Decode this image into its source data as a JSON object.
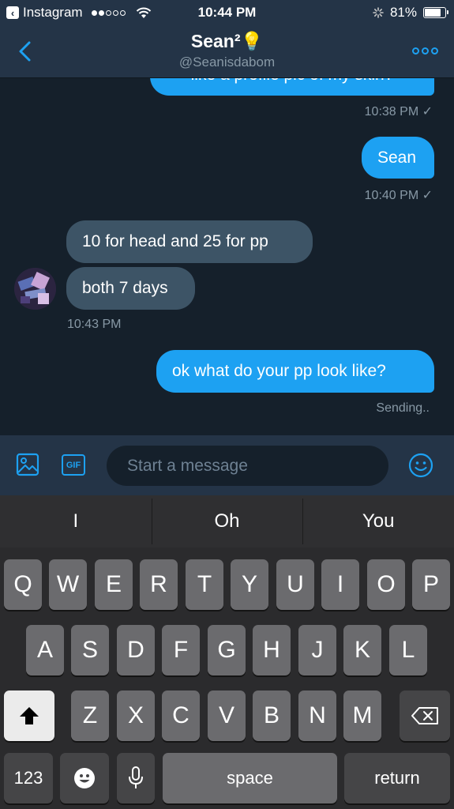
{
  "status_bar": {
    "back_app": "Instagram",
    "time": "10:44 PM",
    "battery": "81%",
    "battery_level": 0.81
  },
  "header": {
    "title": "Sean²💡",
    "handle": "@Seanisdabom"
  },
  "messages": {
    "m1": {
      "text": "like a profile pic of my skin?",
      "meta": "10:38 PM ✓"
    },
    "m2": {
      "text": "Sean",
      "meta": "10:40 PM ✓"
    },
    "m3": {
      "text": "10 for head and 25 for pp"
    },
    "m4": {
      "text": "both 7 days",
      "meta": "10:43 PM"
    },
    "m5": {
      "text": "ok what do your pp look like?",
      "meta": "Sending.."
    }
  },
  "composer": {
    "placeholder": "Start a message",
    "gif_label": "GIF"
  },
  "keyboard": {
    "suggestions": [
      "I",
      "Oh",
      "You"
    ],
    "row1": [
      "Q",
      "W",
      "E",
      "R",
      "T",
      "Y",
      "U",
      "I",
      "O",
      "P"
    ],
    "row2": [
      "A",
      "S",
      "D",
      "F",
      "G",
      "H",
      "J",
      "K",
      "L"
    ],
    "row3": [
      "Z",
      "X",
      "C",
      "V",
      "B",
      "N",
      "M"
    ],
    "numbers_label": "123",
    "space_label": "space",
    "return_label": "return"
  },
  "colors": {
    "accent": "#1da1f2",
    "background": "#15202b",
    "bar": "#243447",
    "incoming_bubble": "#3d5466"
  }
}
